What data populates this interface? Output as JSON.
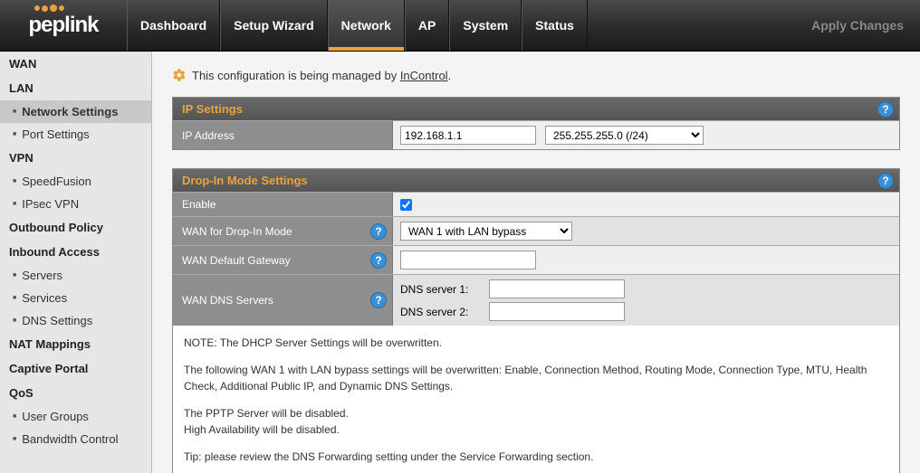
{
  "brand": {
    "name": "peplink"
  },
  "topnav": {
    "items": [
      "Dashboard",
      "Setup Wizard",
      "Network",
      "AP",
      "System",
      "Status"
    ],
    "active": "Network",
    "apply": "Apply Changes"
  },
  "sidebar": [
    {
      "type": "section",
      "label": "WAN"
    },
    {
      "type": "section",
      "label": "LAN"
    },
    {
      "type": "item",
      "label": "Network Settings",
      "active": true
    },
    {
      "type": "item",
      "label": "Port Settings"
    },
    {
      "type": "section",
      "label": "VPN"
    },
    {
      "type": "item",
      "label": "SpeedFusion"
    },
    {
      "type": "item",
      "label": "IPsec VPN"
    },
    {
      "type": "section",
      "label": "Outbound Policy"
    },
    {
      "type": "section",
      "label": "Inbound Access"
    },
    {
      "type": "item",
      "label": "Servers"
    },
    {
      "type": "item",
      "label": "Services"
    },
    {
      "type": "item",
      "label": "DNS Settings"
    },
    {
      "type": "section",
      "label": "NAT Mappings"
    },
    {
      "type": "section",
      "label": "Captive Portal"
    },
    {
      "type": "section",
      "label": "QoS"
    },
    {
      "type": "item",
      "label": "User Groups"
    },
    {
      "type": "item",
      "label": "Bandwidth Control"
    }
  ],
  "notice": {
    "prefix": "This configuration is being managed by ",
    "link": "InControl",
    "suffix": "."
  },
  "ip_panel": {
    "title": "IP Settings",
    "row_label": "IP Address",
    "ip_value": "192.168.1.1",
    "mask_value": "255.255.255.0 (/24)"
  },
  "dropin_panel": {
    "title": "Drop-In Mode Settings",
    "rows": {
      "enable": {
        "label": "Enable",
        "checked": true
      },
      "wan": {
        "label": "WAN for Drop-In Mode",
        "value": "WAN 1 with LAN bypass"
      },
      "gateway": {
        "label": "WAN Default Gateway",
        "value": ""
      },
      "dns": {
        "label": "WAN DNS Servers",
        "dns1_label": "DNS server 1:",
        "dns1_value": "",
        "dns2_label": "DNS server 2:",
        "dns2_value": ""
      }
    },
    "note": {
      "p1": "NOTE: The DHCP Server Settings will be overwritten.",
      "p2": "The following WAN 1 with LAN bypass settings will be overwritten: Enable, Connection Method, Routing Mode, Connection Type, MTU, Health Check, Additional Public IP, and Dynamic DNS Settings.",
      "p3": "The PPTP Server will be disabled.",
      "p4": "High Availability will be disabled.",
      "p5": "Tip: please review the DNS Forwarding setting under the Service Forwarding section."
    }
  },
  "help_glyph": "?"
}
